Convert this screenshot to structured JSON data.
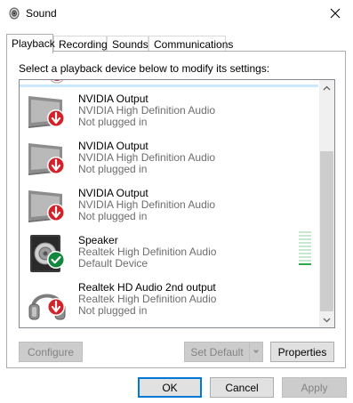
{
  "window": {
    "title": "Sound",
    "icon": "speaker-app-icon"
  },
  "tabs": [
    {
      "label": "Playback",
      "active": true
    },
    {
      "label": "Recording",
      "active": false
    },
    {
      "label": "Sounds",
      "active": false
    },
    {
      "label": "Communications",
      "active": false
    }
  ],
  "instruction": "Select a playback device below to modify its settings:",
  "devices": [
    {
      "name": "NVIDIA Output",
      "driver": "NVIDIA High Definition Audio",
      "status": "Not plugged in",
      "icon": "monitor-icon",
      "badge": "unplugged-badge-icon"
    },
    {
      "name": "NVIDIA Output",
      "driver": "NVIDIA High Definition Audio",
      "status": "Not plugged in",
      "icon": "monitor-icon",
      "badge": "unplugged-badge-icon"
    },
    {
      "name": "NVIDIA Output",
      "driver": "NVIDIA High Definition Audio",
      "status": "Not plugged in",
      "icon": "monitor-icon",
      "badge": "unplugged-badge-icon"
    },
    {
      "name": "Speaker",
      "driver": "Realtek High Definition Audio",
      "status": "Default Device",
      "icon": "speaker-icon",
      "badge": "default-check-badge-icon"
    },
    {
      "name": "Realtek HD Audio 2nd output",
      "driver": "Realtek High Definition Audio",
      "status": "Not plugged in",
      "icon": "headphones-icon",
      "badge": "unplugged-badge-icon"
    }
  ],
  "level_meter": {
    "lit_fraction": 0.1
  },
  "buttons": {
    "configure": "Configure",
    "set_default": "Set Default",
    "properties": "Properties",
    "ok": "OK",
    "cancel": "Cancel",
    "apply": "Apply"
  },
  "colors": {
    "accent": "#0078d7",
    "unplugged_badge": "#d3222a",
    "default_badge": "#10893e",
    "meter_green": "#2ea84a",
    "meter_gray": "#c9e6d1"
  }
}
